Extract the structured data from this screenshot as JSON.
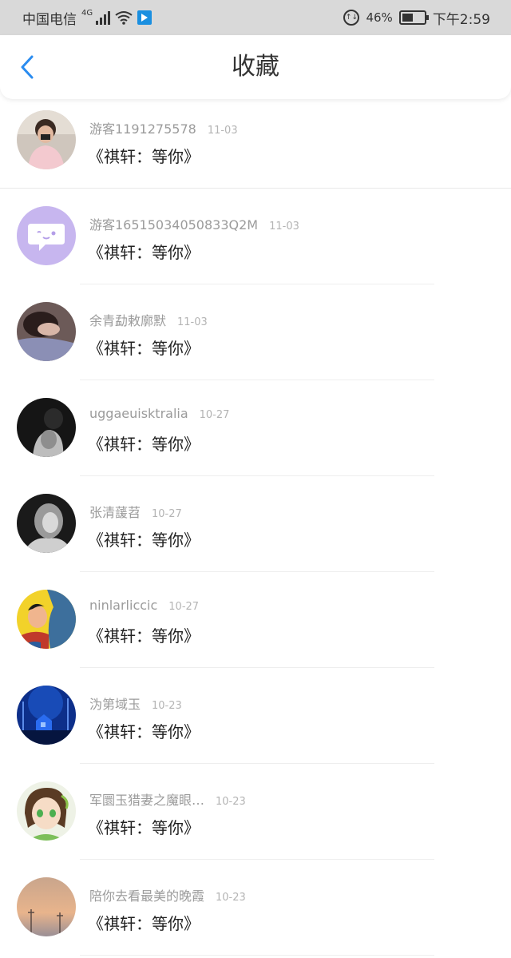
{
  "status_bar": {
    "carrier": "中国电信",
    "network": "4G",
    "battery_percent": "46%",
    "time": "下午2:59",
    "icons": [
      "signal-icon",
      "wifi-icon",
      "nfc-icon",
      "data-saver-icon",
      "battery-icon"
    ]
  },
  "header": {
    "title": "收藏",
    "back_icon": "chevron-left-icon",
    "accent_color": "#2a8cf0"
  },
  "items": [
    {
      "username": "游客1191275578",
      "date": "11-03",
      "title": "《祺轩：等你》",
      "avatar": "selfie-photo-avatar"
    },
    {
      "username": "游客16515034050833Q2M",
      "date": "11-03",
      "title": "《祺轩：等你》",
      "avatar": "default-chat-avatar"
    },
    {
      "username": "余青勐敕廓默",
      "date": "11-03",
      "title": "《祺轩：等你》",
      "avatar": "lying-figure-photo-avatar"
    },
    {
      "username": "uggaeuisktralia",
      "date": "10-27",
      "title": "《祺轩：等你》",
      "avatar": "bw-portrait-avatar"
    },
    {
      "username": "张清蘐苕",
      "date": "10-27",
      "title": "《祺轩：等你》",
      "avatar": "bw-woman-avatar"
    },
    {
      "username": "ninlarliccic",
      "date": "10-27",
      "title": "《祺轩：等你》",
      "avatar": "comic-kiss-avatar"
    },
    {
      "username": "沩第域玉",
      "date": "10-23",
      "title": "《祺轩：等你》",
      "avatar": "blue-night-scene-avatar"
    },
    {
      "username": "军圜玉猎妻之魔眼…",
      "date": "10-23",
      "title": "《祺轩：等你》",
      "avatar": "anime-girl-avatar"
    },
    {
      "username": "陪你去看最美的晚霞",
      "date": "10-23",
      "title": "《祺轩：等你》",
      "avatar": "sunset-sky-avatar"
    }
  ]
}
